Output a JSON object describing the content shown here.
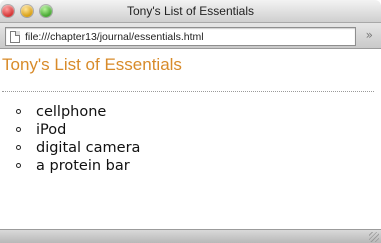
{
  "window": {
    "title": "Tony's List of Essentials"
  },
  "toolbar": {
    "url": "file:///chapter13/journal/essentials.html",
    "overflow_label": "»"
  },
  "page": {
    "heading": "Tony's List of Essentials",
    "items": [
      "cellphone",
      "iPod",
      "digital camera",
      "a protein bar"
    ]
  },
  "colors": {
    "heading": "#d88b2a",
    "close": "#d12b2b",
    "minimize": "#d59a0a",
    "zoom": "#3ea12a"
  }
}
